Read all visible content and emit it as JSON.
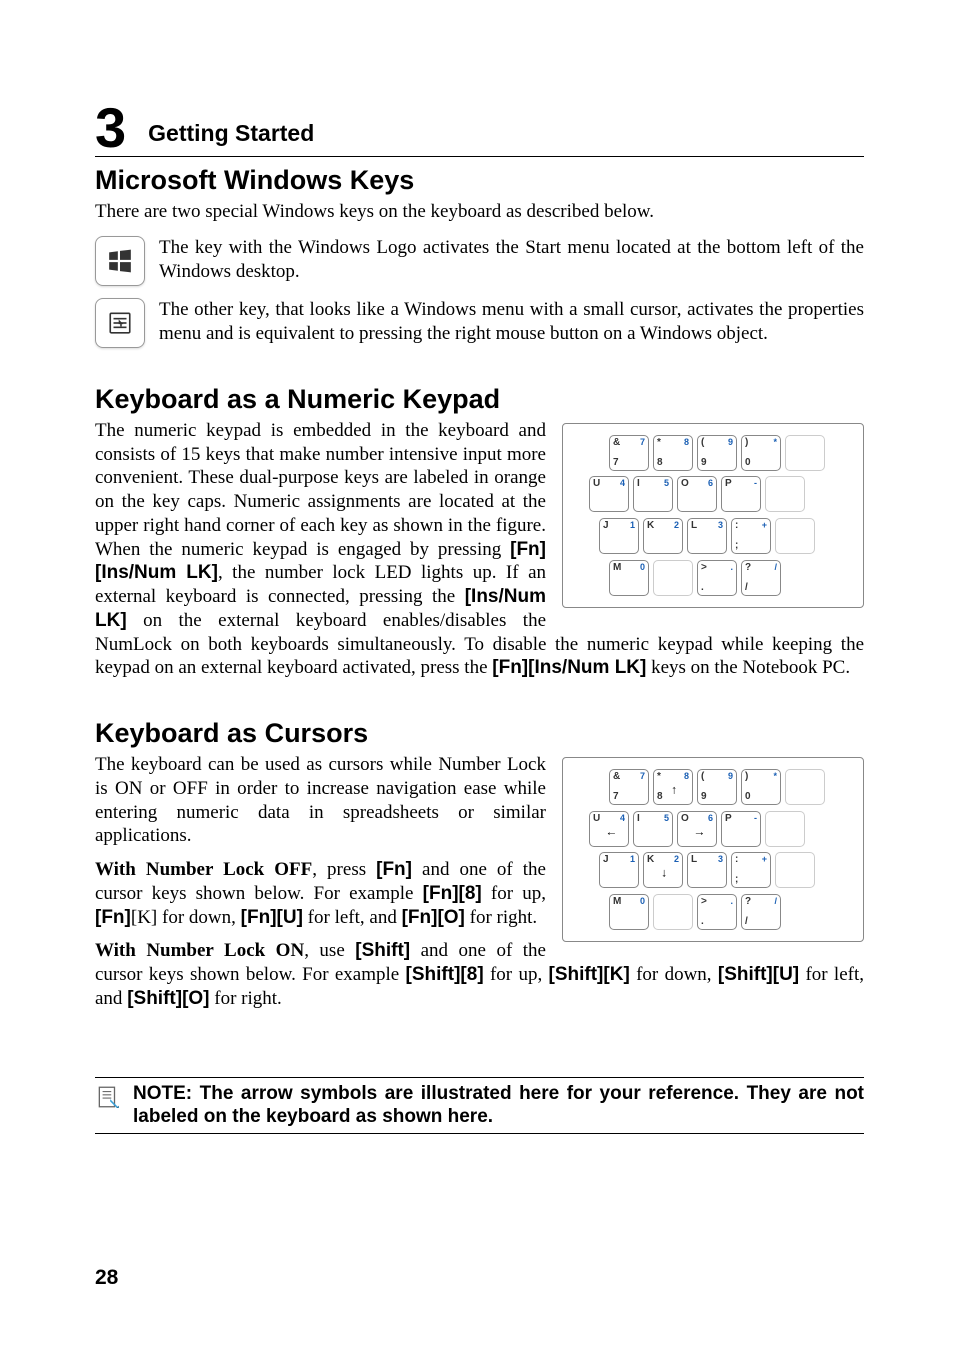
{
  "chapter": {
    "number": "3",
    "title": "Getting Started"
  },
  "sec1": {
    "heading": "Microsoft Windows Keys",
    "intro": "There are two special Windows keys on the keyboard as described below.",
    "key1": "The key with the Windows Logo activates the Start menu located at the bottom left of the Windows desktop.",
    "key2": "The other key, that looks like a Windows menu with a small cursor, activates the properties menu and is equivalent to pressing the right mouse button on a Windows object."
  },
  "sec2": {
    "heading": "Keyboard as a Numeric Keypad",
    "para_a": "The numeric keypad is embedded in the keyboard and consists of 15 keys that make number intensive input more convenient. These dual-purpose keys are labeled in orange on the key caps. Numeric assignments are located at the upper right hand corner of each key as shown in the figure. When the numeric keypad is engaged by pressing ",
    "fn1": "[Fn]",
    "insnum1": "[Ins/Num LK]",
    "para_b": ", the number lock LED lights up. If an external keyboard is connected, pressing the ",
    "insnum2": "[Ins/Num LK]",
    "para_c": " on the external keyboard enables/disables the NumLock on both keyboards simultaneously. To disable the numeric keypad while keeping the keypad on an external keyboard activated, press the  ",
    "fn2": "[Fn]",
    "insnum3": "[Ins/Num LK]",
    "para_d": " keys on the Notebook PC."
  },
  "sec3": {
    "heading": "Keyboard as Cursors",
    "p1": "The keyboard can be used as cursors while Number Lock is ON or OFF in order to increase navigation ease while entering numeric data in spreadsheets or similar applications.",
    "p2a": "With Number Lock OFF",
    "p2b": ", press ",
    "p2_fn": "[Fn]",
    "p2c": " and one of the cursor keys shown below. For example ",
    "p2_fn8a": "[Fn]",
    "p2_8": "[8]",
    "p2d": " for up, ",
    "p2_fnK": "[Fn]",
    "p2_K": "[K]",
    "p2e": " for down, ",
    "p2_fnU": "[Fn]",
    "p2_U": "[U]",
    "p2f": " for left, and ",
    "p2_fnO": "[Fn]",
    "p2_O": "[O]",
    "p2g": " for right.",
    "p3a": "With Number Lock ON",
    "p3b": ", use ",
    "p3_sh": "[Shift]",
    "p3c": " and one of the cursor keys shown below. For example ",
    "p3_sh8": "[Shift]",
    "p3_8": "[8]",
    "p3d": " for up, ",
    "p3_shK": "[Shift]",
    "p3_K": "[K]",
    "p3e": " for down, ",
    "p3_shU": "[Shift]",
    "p3_U": "[U]",
    "p3f": " for left, and ",
    "p3_shO": "[Shift]",
    "p3_O": "[O]",
    "p3g": " for right."
  },
  "note": "NOTE: The arrow symbols are illustrated here for your reference. They are not labeled on the keyboard as shown here.",
  "page_number": "28",
  "keypad": {
    "r1": [
      {
        "tl": "&",
        "bl": "7",
        "tr": "7"
      },
      {
        "tl": "*",
        "bl": "8",
        "tr": "8"
      },
      {
        "tl": "(",
        "bl": "9",
        "tr": "9"
      },
      {
        "tl": ")",
        "bl": "0",
        "tr": "*"
      }
    ],
    "r2": [
      {
        "tl": "U",
        "tr": "4"
      },
      {
        "tl": "I",
        "tr": "5"
      },
      {
        "tl": "O",
        "tr": "6"
      },
      {
        "tl": "P",
        "tr": "-"
      }
    ],
    "r3": [
      {
        "tl": "J",
        "tr": "1"
      },
      {
        "tl": "K",
        "tr": "2"
      },
      {
        "tl": "L",
        "tr": "3"
      },
      {
        "tl": ":",
        "bl": ";",
        "tr": "+"
      }
    ],
    "r4": [
      {
        "tl": "M",
        "tr": "0"
      },
      {
        "tl": ">",
        "bl": ".",
        "tr": "."
      },
      {
        "tl": "?",
        "bl": "/",
        "tr": "/"
      }
    ]
  },
  "keypad2": {
    "r1": [
      {
        "tl": "&",
        "bl": "7",
        "tr": "7"
      },
      {
        "tl": "*",
        "bl": "8",
        "tr": "8",
        "arrow": "↑"
      },
      {
        "tl": "(",
        "bl": "9",
        "tr": "9"
      },
      {
        "tl": ")",
        "bl": "0",
        "tr": "*"
      }
    ],
    "r2": [
      {
        "tl": "U",
        "tr": "4",
        "arrow": "←"
      },
      {
        "tl": "I",
        "tr": "5"
      },
      {
        "tl": "O",
        "tr": "6",
        "arrow": "→"
      },
      {
        "tl": "P",
        "tr": "-"
      }
    ],
    "r3": [
      {
        "tl": "J",
        "tr": "1"
      },
      {
        "tl": "K",
        "tr": "2",
        "arrow": "↓"
      },
      {
        "tl": "L",
        "tr": "3"
      },
      {
        "tl": ":",
        "bl": ";",
        "tr": "+"
      }
    ],
    "r4": [
      {
        "tl": "M",
        "tr": "0"
      },
      {
        "tl": ">",
        "bl": ".",
        "tr": "."
      },
      {
        "tl": "?",
        "bl": "/",
        "tr": "/"
      }
    ]
  }
}
